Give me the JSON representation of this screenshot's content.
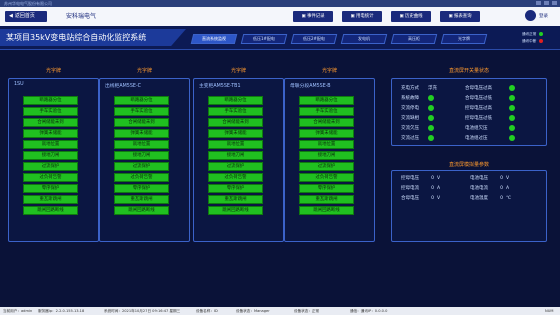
{
  "window": {
    "title": "苏州华电电气股份有限公司"
  },
  "topbar": {
    "home_label": "返回首页",
    "company": "安科瑞电气",
    "buttons": [
      "事件记录",
      "用电统计",
      "历史曲线",
      "报表查询"
    ],
    "user": "登录"
  },
  "header": {
    "title": "某项目35kV变电站综合自动化监控系统",
    "tabs": [
      "直流系统监视",
      "低压1#配电",
      "低压2#配电",
      "发电机",
      "高压柜",
      "光字牌"
    ],
    "active_tab": 0,
    "legend": [
      {
        "label": "通讯正常",
        "color": "#22d022"
      },
      {
        "label": "通讯中断",
        "color": "#e02020"
      }
    ]
  },
  "panels": [
    {
      "title": "光字牌",
      "device": "1SU",
      "items": [
        "断路器分位",
        "手车实验位",
        "合闸储能未到",
        "弹簧未储能",
        "就地位置",
        "接地刀闸",
        "过流保护",
        "过负荷告警",
        "零序保护",
        "重瓦斯跳闸",
        "跳闸回路断线"
      ]
    },
    {
      "title": "光字牌",
      "device": "出线柜AM5SE-C",
      "items": [
        "断路器分位",
        "手车实验位",
        "合闸储能未到",
        "弹簧未储能",
        "就地位置",
        "接地刀闸",
        "过流保护",
        "过负荷告警",
        "零序保护",
        "重瓦斯跳闸",
        "跳闸回路断线"
      ]
    },
    {
      "title": "光字牌",
      "device": "主变柜AM5SE-TB1",
      "items": [
        "断路器分位",
        "手车实验位",
        "合闸储能未到",
        "弹簧未储能",
        "就地位置",
        "接地刀闸",
        "过流保护",
        "过负荷告警",
        "零序保护",
        "重瓦斯跳闸",
        "跳闸回路断线"
      ]
    },
    {
      "title": "光字牌",
      "device": "母联分段AM5SE-B",
      "items": [
        "断路器分位",
        "手车实验位",
        "合闸储能未到",
        "弹簧未储能",
        "就地位置",
        "接地刀闸",
        "过流保护",
        "过负荷告警",
        "零序保护",
        "重瓦斯跳闸",
        "跳闸回路断线"
      ]
    }
  ],
  "dc_switch": {
    "title": "直流屏开关量状态",
    "left": [
      {
        "label": "充电方式",
        "value": "浮充"
      },
      {
        "label": "系统故障",
        "value": ""
      },
      {
        "label": "交流停电",
        "value": ""
      },
      {
        "label": "交流缺相",
        "value": ""
      },
      {
        "label": "交流欠压",
        "value": ""
      },
      {
        "label": "交流过压",
        "value": ""
      }
    ],
    "right": [
      "合母电压过高",
      "合母电压过低",
      "控母电压过高",
      "控母电压过低",
      "电池组欠压",
      "电池组过压"
    ]
  },
  "dc_measure": {
    "title": "直流屏模拟量参数",
    "left": [
      {
        "label": "控母电压",
        "value": "0",
        "unit": "V"
      },
      {
        "label": "控母电流",
        "value": "0",
        "unit": "A"
      },
      {
        "label": "合母电压",
        "value": "0",
        "unit": "V"
      }
    ],
    "right": [
      {
        "label": "电池电压",
        "value": "0",
        "unit": "V"
      },
      {
        "label": "电池电流",
        "value": "0",
        "unit": "A"
      },
      {
        "label": "电池温度",
        "value": "0",
        "unit": "℃"
      }
    ]
  },
  "statusbar": {
    "items": [
      "当前用户：admin",
      "服务器ip：2.2.0.155.13.18",
      "系统时间：2021年10月27日  09:16:47  星期三",
      "设备名称：ID",
      "设备状态：Manager",
      "设备状态：正常",
      "通信：通讯IP：0.0.0.0",
      "NUM"
    ]
  }
}
